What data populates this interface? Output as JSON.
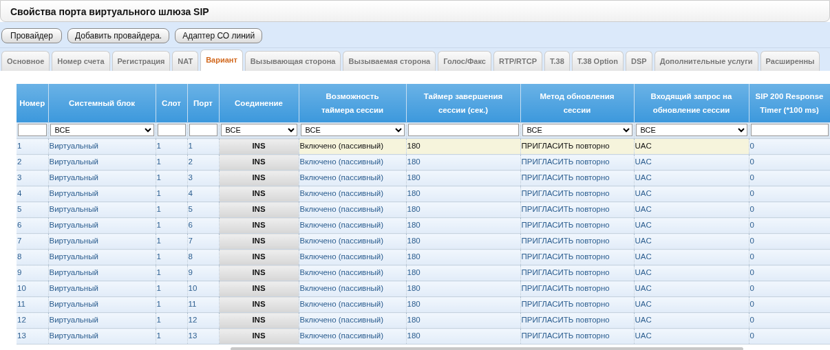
{
  "window": {
    "title": "Свойства порта виртуального шлюза SIP"
  },
  "toolbar": [
    "Провайдер",
    "Добавить провайдера.",
    "Адаптер СО линий"
  ],
  "tabs": [
    {
      "label": "Основное",
      "selected": false
    },
    {
      "label": "Номер счета",
      "selected": false
    },
    {
      "label": "Регистрация",
      "selected": false
    },
    {
      "label": "NAT",
      "selected": false
    },
    {
      "label": "Вариант",
      "selected": true
    },
    {
      "label": "Вызывающая сторона",
      "selected": false
    },
    {
      "label": "Вызываемая сторона",
      "selected": false
    },
    {
      "label": "Голос/Факс",
      "selected": false
    },
    {
      "label": "RTP/RTCP",
      "selected": false
    },
    {
      "label": "T.38",
      "selected": false
    },
    {
      "label": "T.38 Option",
      "selected": false
    },
    {
      "label": "DSP",
      "selected": false
    },
    {
      "label": "Дополнительные услуги",
      "selected": false
    },
    {
      "label": "Расширенны",
      "selected": false
    }
  ],
  "table": {
    "columns": [
      "Номер",
      "Системный блок",
      "Слот",
      "Порт",
      "Соединение",
      "Возможность таймера сессии",
      "Таймер завершения сессии (сек.)",
      "Метод обновления сессии",
      "Входящий запрос на обновление сессии",
      "SIP 200 Response Timer (*100 ms)"
    ],
    "filters": [
      {
        "kind": "text"
      },
      {
        "kind": "select",
        "value": "ВСЕ"
      },
      {
        "kind": "text"
      },
      {
        "kind": "text"
      },
      {
        "kind": "select",
        "value": "ВСЕ"
      },
      {
        "kind": "select",
        "value": "ВСЕ"
      },
      {
        "kind": "text"
      },
      {
        "kind": "select",
        "value": "ВСЕ"
      },
      {
        "kind": "select",
        "value": "ВСЕ"
      },
      {
        "kind": "text"
      }
    ],
    "rows": [
      {
        "selected": true,
        "cells": [
          "1",
          "Виртуальный",
          "1",
          "1",
          "INS",
          "Включено (пассивный)",
          "180",
          "ПРИГЛАСИТЬ повторно",
          "UAC",
          "0"
        ]
      },
      {
        "selected": false,
        "cells": [
          "2",
          "Виртуальный",
          "1",
          "2",
          "INS",
          "Включено (пассивный)",
          "180",
          "ПРИГЛАСИТЬ повторно",
          "UAC",
          "0"
        ]
      },
      {
        "selected": false,
        "cells": [
          "3",
          "Виртуальный",
          "1",
          "3",
          "INS",
          "Включено (пассивный)",
          "180",
          "ПРИГЛАСИТЬ повторно",
          "UAC",
          "0"
        ]
      },
      {
        "selected": false,
        "cells": [
          "4",
          "Виртуальный",
          "1",
          "4",
          "INS",
          "Включено (пассивный)",
          "180",
          "ПРИГЛАСИТЬ повторно",
          "UAC",
          "0"
        ]
      },
      {
        "selected": false,
        "cells": [
          "5",
          "Виртуальный",
          "1",
          "5",
          "INS",
          "Включено (пассивный)",
          "180",
          "ПРИГЛАСИТЬ повторно",
          "UAC",
          "0"
        ]
      },
      {
        "selected": false,
        "cells": [
          "6",
          "Виртуальный",
          "1",
          "6",
          "INS",
          "Включено (пассивный)",
          "180",
          "ПРИГЛАСИТЬ повторно",
          "UAC",
          "0"
        ]
      },
      {
        "selected": false,
        "cells": [
          "7",
          "Виртуальный",
          "1",
          "7",
          "INS",
          "Включено (пассивный)",
          "180",
          "ПРИГЛАСИТЬ повторно",
          "UAC",
          "0"
        ]
      },
      {
        "selected": false,
        "cells": [
          "8",
          "Виртуальный",
          "1",
          "8",
          "INS",
          "Включено (пассивный)",
          "180",
          "ПРИГЛАСИТЬ повторно",
          "UAC",
          "0"
        ]
      },
      {
        "selected": false,
        "cells": [
          "9",
          "Виртуальный",
          "1",
          "9",
          "INS",
          "Включено (пассивный)",
          "180",
          "ПРИГЛАСИТЬ повторно",
          "UAC",
          "0"
        ]
      },
      {
        "selected": false,
        "cells": [
          "10",
          "Виртуальный",
          "1",
          "10",
          "INS",
          "Включено (пассивный)",
          "180",
          "ПРИГЛАСИТЬ повторно",
          "UAC",
          "0"
        ]
      },
      {
        "selected": false,
        "cells": [
          "11",
          "Виртуальный",
          "1",
          "11",
          "INS",
          "Включено (пассивный)",
          "180",
          "ПРИГЛАСИТЬ повторно",
          "UAC",
          "0"
        ]
      },
      {
        "selected": false,
        "cells": [
          "12",
          "Виртуальный",
          "1",
          "12",
          "INS",
          "Включено (пассивный)",
          "180",
          "ПРИГЛАСИТЬ повторно",
          "UAC",
          "0"
        ]
      },
      {
        "selected": false,
        "cells": [
          "13",
          "Виртуальный",
          "1",
          "13",
          "INS",
          "Включено (пассивный)",
          "180",
          "ПРИГЛАСИТЬ повторно",
          "UAC",
          "0"
        ]
      }
    ]
  }
}
